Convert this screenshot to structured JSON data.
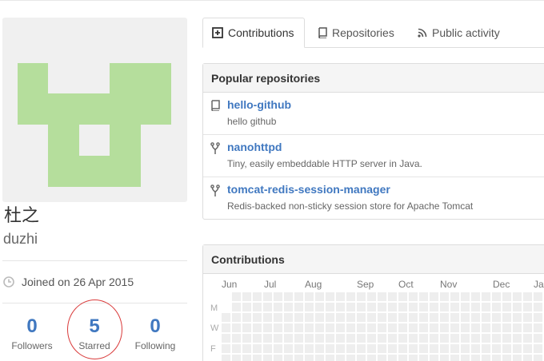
{
  "profile": {
    "fullname": "杜之",
    "login": "duzhi",
    "joined_text": "Joined on 26 Apr 2015",
    "stats": [
      {
        "count": "0",
        "label": "Followers"
      },
      {
        "count": "5",
        "label": "Starred"
      },
      {
        "count": "0",
        "label": "Following"
      }
    ]
  },
  "tabs": [
    {
      "label": "Contributions",
      "icon": "contributions-icon",
      "active": true
    },
    {
      "label": "Repositories",
      "icon": "repo-icon",
      "active": false
    },
    {
      "label": "Public activity",
      "icon": "rss-icon",
      "active": false
    }
  ],
  "popular": {
    "title": "Popular repositories",
    "repos": [
      {
        "name": "hello-github",
        "description": "hello github",
        "icon": "repo-icon"
      },
      {
        "name": "nanohttpd",
        "description": "Tiny, easily embeddable HTTP server in Java.",
        "icon": "fork-icon"
      },
      {
        "name": "tomcat-redis-session-manager",
        "description": "Redis-backed non-sticky session store for Apache Tomcat",
        "icon": "fork-icon"
      }
    ]
  },
  "contributions": {
    "title": "Contributions",
    "months": [
      "Jun",
      "Jul",
      "Aug",
      "Sep",
      "Oct",
      "Nov",
      "Dec",
      "Ja"
    ],
    "days": [
      "M",
      "W",
      "F"
    ]
  },
  "colors": {
    "link": "#4078c0",
    "avatar_fill": "#b5de9c",
    "empty_cell": "#eeeeee",
    "annotation": "#d93a3a"
  }
}
